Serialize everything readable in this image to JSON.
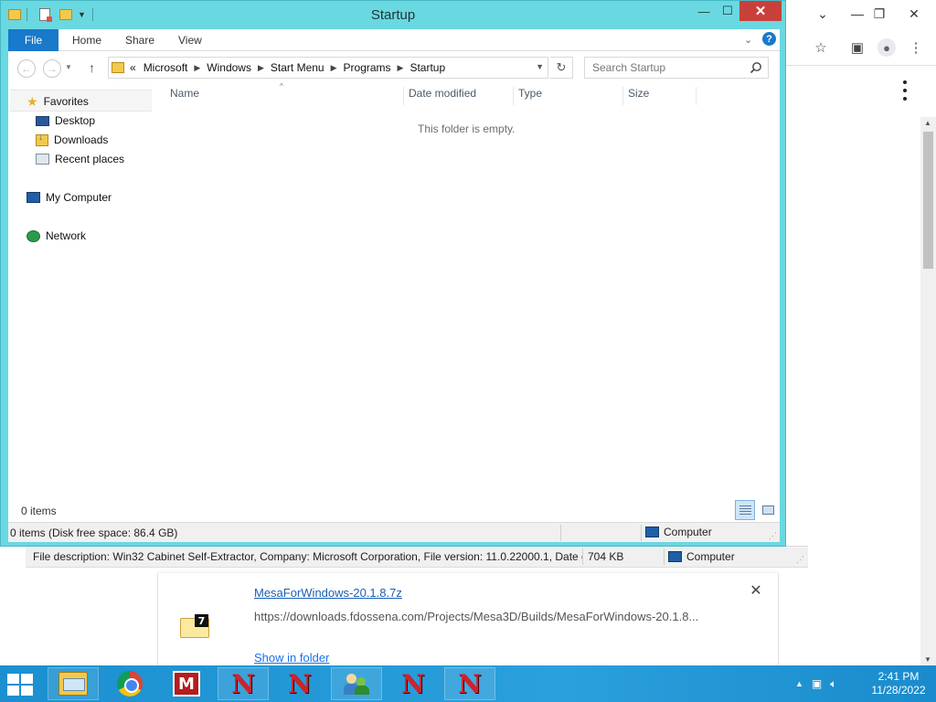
{
  "explorer": {
    "title": "Startup",
    "ribbon_tabs": [
      "File",
      "Home",
      "Share",
      "View"
    ],
    "breadcrumb": [
      "Microsoft",
      "Windows",
      "Start Menu",
      "Programs",
      "Startup"
    ],
    "breadcrumb_overflow": "«",
    "search_placeholder": "Search Startup",
    "nav_pane": {
      "favorites": "Favorites",
      "favorite_items": [
        "Desktop",
        "Downloads",
        "Recent places"
      ],
      "computer": "My Computer",
      "network": "Network"
    },
    "columns": [
      "Name",
      "Date modified",
      "Type",
      "Size"
    ],
    "empty_message": "This folder is empty.",
    "item_count": "0 items",
    "status_text": "0 items (Disk free space: 86.4 GB)",
    "status_location": "Computer"
  },
  "background_status": {
    "description": "File description: Win32 Cabinet Self-Extractor, Company: Microsoft Corporation, File version: 11.0.22000.1, Date cre",
    "size": "704 KB",
    "location": "Computer"
  },
  "download": {
    "filename": "MesaForWindows-20.1.8.7z",
    "url": "https://downloads.fdossena.com/Projects/Mesa3D/Builds/MesaForWindows-20.1.8...",
    "show_in_folder": "Show in folder"
  },
  "taskbar": {
    "time": "2:41 PM",
    "date": "11/28/2022"
  },
  "colors": {
    "explorer_frame": "#6ad8e0",
    "file_tab": "#1979ca",
    "close_button": "#c9403a",
    "taskbar": "#2aa0dc",
    "link": "#1a73e8"
  }
}
